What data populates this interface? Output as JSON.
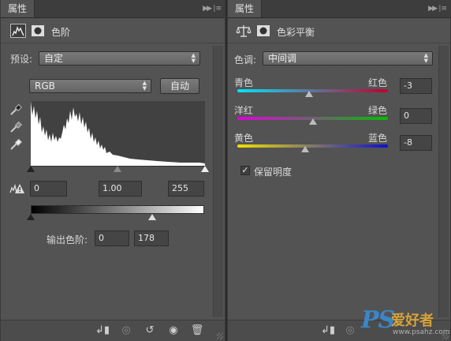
{
  "levels_panel": {
    "tab_label": "属性",
    "title": "色阶",
    "preset_label": "预设:",
    "preset_value": "自定",
    "channel_value": "RGB",
    "auto_button": "自动",
    "input_black": "0",
    "input_gamma": "1.00",
    "input_white": "255",
    "output_label": "输出色阶:",
    "output_black": "0",
    "output_white": "178"
  },
  "color_balance_panel": {
    "tab_label": "属性",
    "title": "色彩平衡",
    "tone_label": "色调:",
    "tone_value": "中间调",
    "sliders": [
      {
        "left": "青色",
        "right": "红色",
        "value": "-3"
      },
      {
        "left": "洋红",
        "right": "绿色",
        "value": "0"
      },
      {
        "left": "黄色",
        "right": "蓝色",
        "value": "-8"
      }
    ],
    "preserve_label": "保留明度",
    "preserve_checked": true
  },
  "watermark": {
    "logo": "PS",
    "text": "爱好者",
    "url": "www.psahz.com"
  },
  "colors": {
    "panel_bg": "#535353",
    "tab_bg": "#3d3d3d",
    "histogram_bg": "#414141"
  }
}
